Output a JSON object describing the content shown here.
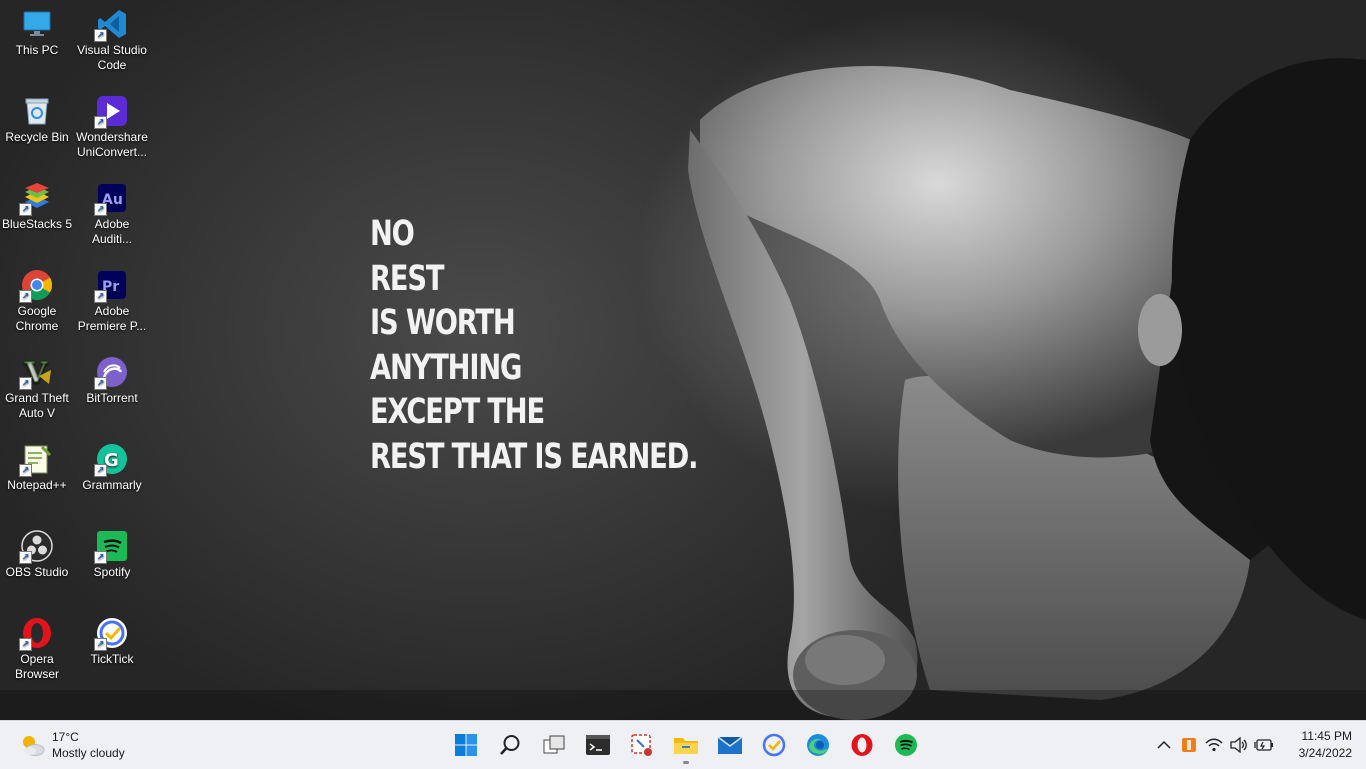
{
  "wallpaper": {
    "quote_lines": [
      "NO",
      "REST",
      "IS WORTH",
      "ANYTHING",
      "EXCEPT THE",
      "REST THAT IS EARNED."
    ]
  },
  "desktop_icons": [
    {
      "label": "This PC",
      "icon": "computer-icon",
      "shortcut": false
    },
    {
      "label": "Visual Studio Code",
      "icon": "vscode-icon",
      "shortcut": true
    },
    {
      "label": "Recycle Bin",
      "icon": "recycle-bin-icon",
      "shortcut": false
    },
    {
      "label": "Wondershare UniConvert...",
      "icon": "uniconverter-icon",
      "shortcut": true
    },
    {
      "label": "BlueStacks 5",
      "icon": "bluestacks-icon",
      "shortcut": true
    },
    {
      "label": "Adobe Auditi...",
      "icon": "adobe-audition-icon",
      "shortcut": true
    },
    {
      "label": "Google Chrome",
      "icon": "chrome-icon",
      "shortcut": true
    },
    {
      "label": "Adobe Premiere P...",
      "icon": "adobe-premiere-icon",
      "shortcut": true
    },
    {
      "label": "Grand Theft Auto V",
      "icon": "gta-v-icon",
      "shortcut": true
    },
    {
      "label": "BitTorrent",
      "icon": "bittorrent-icon",
      "shortcut": true
    },
    {
      "label": "Notepad++",
      "icon": "notepad-plus-plus-icon",
      "shortcut": true
    },
    {
      "label": "Grammarly",
      "icon": "grammarly-icon",
      "shortcut": true
    },
    {
      "label": "OBS Studio",
      "icon": "obs-studio-icon",
      "shortcut": true
    },
    {
      "label": "Spotify",
      "icon": "spotify-icon",
      "shortcut": true
    },
    {
      "label": "Opera Browser",
      "icon": "opera-icon",
      "shortcut": true
    },
    {
      "label": "TickTick",
      "icon": "ticktick-icon",
      "shortcut": true
    }
  ],
  "taskbar": {
    "weather": {
      "temperature": "17°C",
      "condition": "Mostly cloudy",
      "icon": "partly-cloudy-icon"
    },
    "apps": [
      {
        "icon": "windows-start-icon",
        "running": false
      },
      {
        "icon": "search-icon",
        "running": false
      },
      {
        "icon": "task-view-icon",
        "running": false
      },
      {
        "icon": "terminal-icon",
        "running": false
      },
      {
        "icon": "snipping-tool-icon",
        "running": false
      },
      {
        "icon": "file-explorer-icon",
        "running": true
      },
      {
        "icon": "mail-icon",
        "running": false
      },
      {
        "icon": "ticktick-icon",
        "running": false
      },
      {
        "icon": "edge-icon",
        "running": false
      },
      {
        "icon": "opera-icon",
        "running": false
      },
      {
        "icon": "spotify-icon",
        "running": false
      }
    ],
    "tray": {
      "icons": [
        "chevron-up-icon",
        "app-tray-icon",
        "wifi-icon",
        "volume-icon",
        "battery-charging-icon"
      ],
      "time": "11:45 PM",
      "date": "3/24/2022"
    }
  },
  "colors": {
    "taskbar_bg": "#eef0f4",
    "spotify_green": "#1db954",
    "opera_red": "#e3131b",
    "windows_blue": "#0a7cd9"
  }
}
